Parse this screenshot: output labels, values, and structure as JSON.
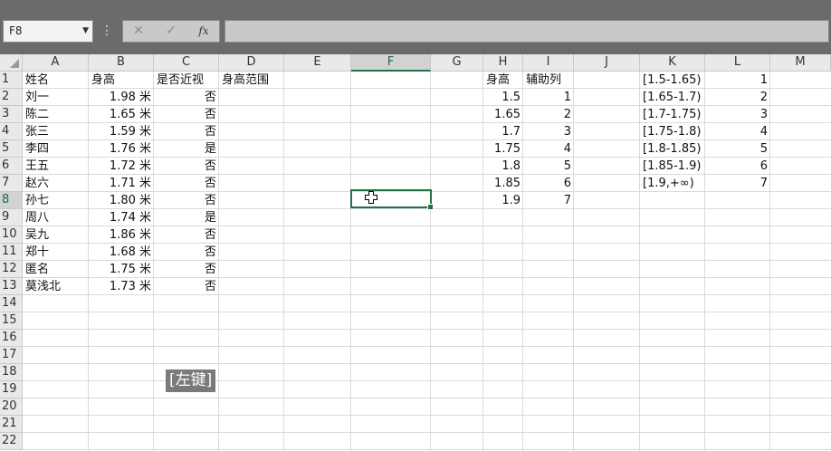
{
  "formula_bar": {
    "name_box": "F8",
    "fx_label": "fx",
    "formula": ""
  },
  "columns": [
    "A",
    "B",
    "C",
    "D",
    "E",
    "F",
    "G",
    "H",
    "I",
    "J",
    "K",
    "L",
    "M"
  ],
  "rows": [
    "1",
    "2",
    "3",
    "4",
    "5",
    "6",
    "7",
    "8",
    "9",
    "10",
    "11",
    "12",
    "13",
    "14",
    "15",
    "16",
    "17",
    "18",
    "19",
    "20",
    "21",
    "22"
  ],
  "selected_column": "F",
  "selected_row": "8",
  "table_main": {
    "headers": [
      "姓名",
      "身高",
      "是否近视",
      "身高范围"
    ],
    "rows": [
      [
        "刘一",
        "1.98 米",
        "否"
      ],
      [
        "陈二",
        "1.65 米",
        "否"
      ],
      [
        "张三",
        "1.59 米",
        "否"
      ],
      [
        "李四",
        "1.76 米",
        "是"
      ],
      [
        "王五",
        "1.72 米",
        "否"
      ],
      [
        "赵六",
        "1.71 米",
        "否"
      ],
      [
        "孙七",
        "1.80 米",
        "否"
      ],
      [
        "周八",
        "1.74 米",
        "是"
      ],
      [
        "吴九",
        "1.86 米",
        "否"
      ],
      [
        "郑十",
        "1.68 米",
        "否"
      ],
      [
        "匿名",
        "1.75 米",
        "否"
      ],
      [
        "莫浅北",
        "1.73 米",
        "否"
      ]
    ]
  },
  "table_lookup": {
    "headers": [
      "身高",
      "辅助列"
    ],
    "rows": [
      [
        "1.5",
        "1"
      ],
      [
        "1.65",
        "2"
      ],
      [
        "1.7",
        "3"
      ],
      [
        "1.75",
        "4"
      ],
      [
        "1.8",
        "5"
      ],
      [
        "1.85",
        "6"
      ],
      [
        "1.9",
        "7"
      ]
    ]
  },
  "table_ranges": {
    "rows": [
      [
        "[1.5-1.65)",
        "1"
      ],
      [
        "[1.65-1.7)",
        "2"
      ],
      [
        "[1.7-1.75)",
        "3"
      ],
      [
        "[1.75-1.8)",
        "4"
      ],
      [
        "[1.8-1.85)",
        "5"
      ],
      [
        "[1.85-1.9)",
        "6"
      ],
      [
        "[1.9,+∞)",
        "7"
      ]
    ]
  },
  "tooltip": "[左键]"
}
